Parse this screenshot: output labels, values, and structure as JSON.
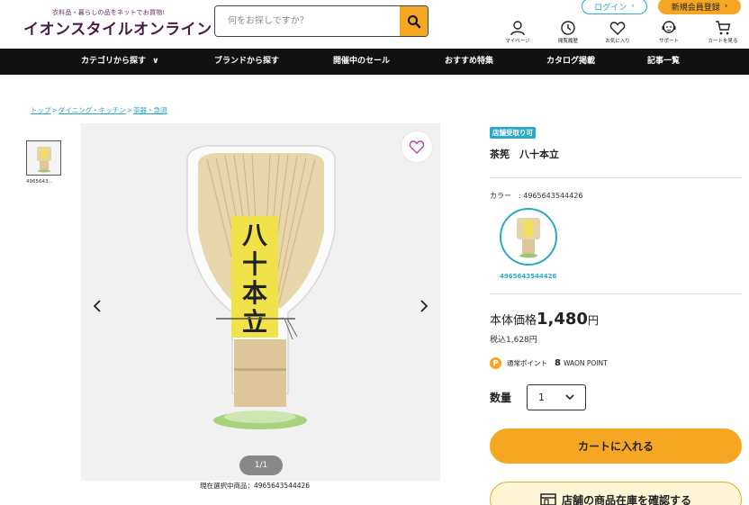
{
  "header": {
    "tagline": "衣料品・暮らしの品をネットでお買物!",
    "logo": "イオンスタイルオンライン",
    "search_placeholder": "何をお探しですか？",
    "login": "ログイン",
    "register": "新規会員登録",
    "icons": [
      {
        "icon": "user-icon",
        "label": "マイページ"
      },
      {
        "icon": "clock-icon",
        "label": "閲覧履歴"
      },
      {
        "icon": "heart-icon",
        "label": "お気に入り"
      },
      {
        "icon": "support-icon",
        "label": "サポート"
      },
      {
        "icon": "cart-icon",
        "label": "カートを見る"
      }
    ]
  },
  "nav": [
    "カテゴリから探す",
    "ブランドから探す",
    "開催中のセール",
    "おすすめ特集",
    "カタログ掲載",
    "記事一覧"
  ],
  "breadcrumb": [
    "トップ",
    "ダイニング・キッチン",
    "茶器・急須"
  ],
  "breadcrumb_sep": ">",
  "thumbnail_label": "4965643...",
  "gallery": {
    "pager": "1/1",
    "selected_label": "現在選択中商品：4965643544426",
    "image_text": [
      "八",
      "十",
      "本",
      "立"
    ]
  },
  "product": {
    "badge": "店舗受取り可",
    "title": "茶筅　八十本立",
    "color_label": "カラー　: 4965643544426",
    "swatch_label": "4965643544426",
    "price_prefix": "本体価格",
    "price": "1,480",
    "price_unit": "円",
    "tax_included": "税込1,628円",
    "point_badge": "P",
    "point_label": "通常ポイント",
    "point_value": "8",
    "point_unit": "WAON POINT",
    "qty_label": "数量",
    "qty_value": "1",
    "cart_button": "カートに入れる",
    "store_button": "店舗の商品在庫を確認する"
  },
  "colors": {
    "accent": "#f5a623",
    "teal": "#2aa8c7",
    "brand": "#4b1a4a",
    "nav_bg": "#111111"
  }
}
